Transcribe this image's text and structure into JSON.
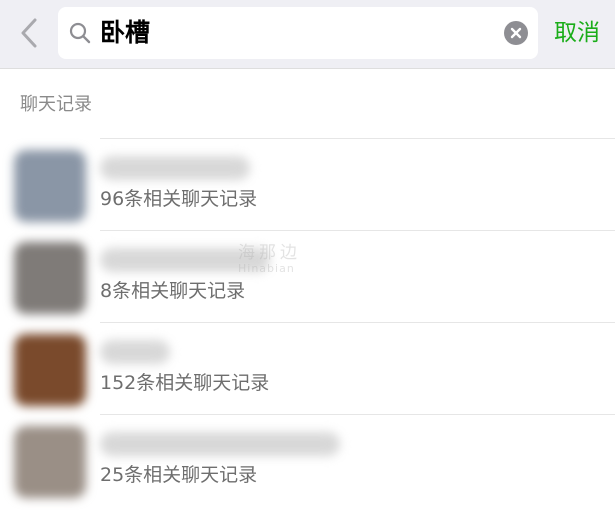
{
  "header": {
    "back_icon": "chevron-left-icon",
    "search_query": "卧槽",
    "search_icon": "search-icon",
    "clear_icon": "clear-icon",
    "cancel_label": "取消",
    "accent_color": "#1aad19"
  },
  "section": {
    "title": "聊天记录"
  },
  "results": [
    {
      "count_text": "96条相关聊天记录",
      "avatar_color": "#8a96a6"
    },
    {
      "count_text": "8条相关聊天记录",
      "avatar_color": "#7f7b78"
    },
    {
      "count_text": "152条相关聊天记录",
      "avatar_color": "#7a4a2c"
    },
    {
      "count_text": "25条相关聊天记录",
      "avatar_color": "#9a8f86"
    }
  ],
  "watermark": {
    "line1": "海那边",
    "line2": "Hinabian"
  }
}
